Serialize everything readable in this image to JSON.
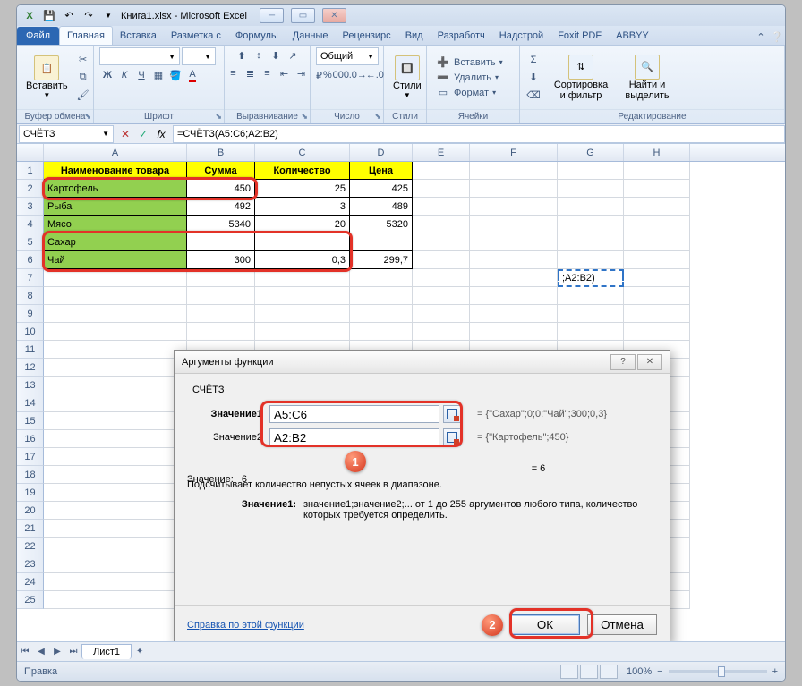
{
  "titlebar": {
    "title": "Книга1.xlsx - Microsoft Excel"
  },
  "qat": {
    "excel": "X",
    "save": "💾",
    "undo": "↶",
    "redo": "↷"
  },
  "ribbon": {
    "tabs": [
      "Файл",
      "Главная",
      "Вставка",
      "Разметка с",
      "Формулы",
      "Данные",
      "Рецензирс",
      "Вид",
      "Разработч",
      "Надстрой",
      "Foxit PDF",
      "ABBYY"
    ],
    "active_index": 1,
    "groups": {
      "clipboard": "Буфер обмена",
      "font": "Шрифт",
      "alignment": "Выравнивание",
      "number": "Число",
      "styles": "Стили",
      "cells": "Ячейки",
      "editing": "Редактирование"
    },
    "paste": "Вставить",
    "styles": "Стили",
    "sort": "Сортировка и фильтр",
    "find": "Найти и выделить",
    "insert_label": "Вставить",
    "delete_label": "Удалить",
    "format_label": "Формат",
    "font_name": "",
    "font_size": "",
    "number_format": "Общий"
  },
  "namebox": "СЧЁТЗ",
  "formula": "=СЧЁТЗ(A5:C6;A2:B2)",
  "grid": {
    "cols": [
      "A",
      "B",
      "C",
      "D",
      "E",
      "F",
      "G",
      "H"
    ],
    "headers": [
      "Наименование товара",
      "Сумма",
      "Количество",
      "Цена"
    ],
    "rows": [
      {
        "n": "1"
      },
      {
        "n": "2",
        "a": "Картофель",
        "b": "450",
        "c": "25",
        "d": "425"
      },
      {
        "n": "3",
        "a": "Рыба",
        "b": "492",
        "c": "3",
        "d": "489"
      },
      {
        "n": "4",
        "a": "Мясо",
        "b": "5340",
        "c": "20",
        "d": "5320"
      },
      {
        "n": "5",
        "a": "Сахар",
        "b": "",
        "c": "",
        "d": ""
      },
      {
        "n": "6",
        "a": "Чай",
        "b": "300",
        "c": "0,3",
        "d": "299,7"
      }
    ],
    "g7": ";A2:B2)"
  },
  "dialog": {
    "title": "Аргументы функции",
    "func": "СЧЁТЗ",
    "arg1_label": "Значение1",
    "arg1_val": "A5:C6",
    "arg1_prev": "= {\"Сахар\";0;0:\"Чай\";300;0,3}",
    "arg2_label": "Значение2",
    "arg2_val": "A2:B2",
    "arg2_prev": "= {\"Картофель\";450}",
    "result_eq": "=  6",
    "desc": "Подсчитывает количество непустых ячеек в диапазоне.",
    "param_head": "Значение1:",
    "param_desc": "значение1;значение2;... от 1 до 255 аргументов любого типа, количество которых требуется определить.",
    "value_label": "Значение:",
    "value": "6",
    "help": "Справка по этой функции",
    "ok": "ОК",
    "cancel": "Отмена"
  },
  "sheet_tab": "Лист1",
  "status": {
    "mode": "Правка",
    "zoom": "100%",
    "minus": "−",
    "plus": "+"
  },
  "callouts": {
    "one": "1",
    "two": "2"
  }
}
